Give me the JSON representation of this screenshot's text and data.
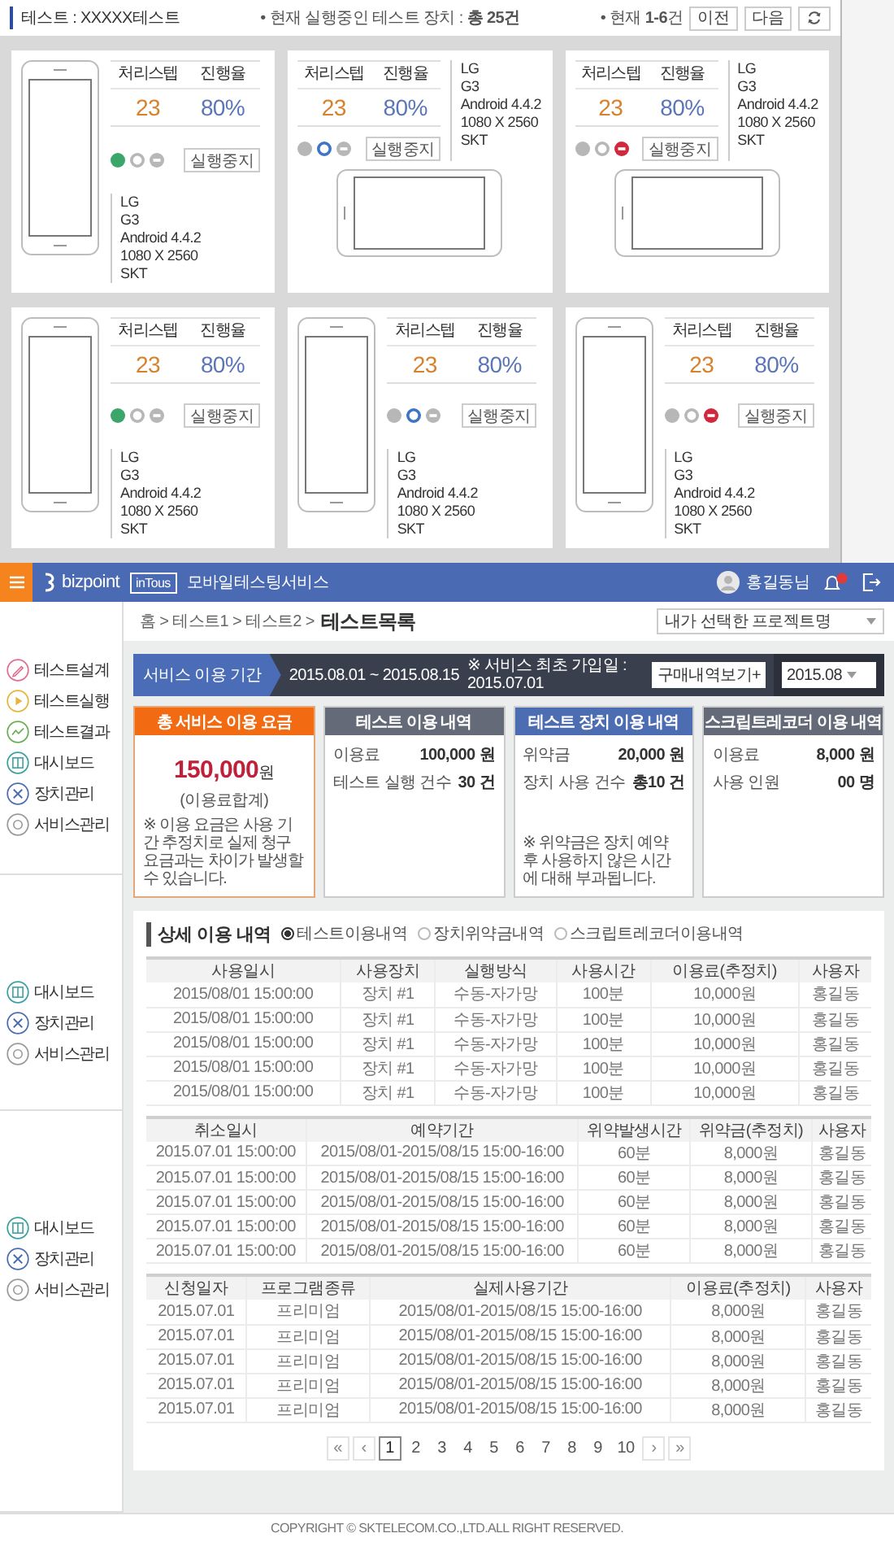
{
  "test_header": {
    "title": "테스트 : XXXXX테스트",
    "running_count": "• 현재 실행중인 테스트 장치 : **총 25건**",
    "page_range": "• 현재 **1-6**건",
    "buttons": [
      "이전",
      "다음"
    ]
  },
  "devices": [
    {
      "kind": "portrait",
      "indicators": [
        {
          "kind": "run",
          "on": true
        },
        {
          "kind": "pause",
          "on": false
        },
        {
          "kind": "stop",
          "on": false
        }
      ],
      "labels": [
        "처리스텝",
        "진행율"
      ],
      "values": [
        "23",
        "80%"
      ],
      "stop_button": "실행중지",
      "info": [
        "LG",
        "G3",
        "Android 4.4.2",
        "1080 X 2560",
        "SKT"
      ]
    },
    {
      "kind": "landscape",
      "indicators": [
        {
          "kind": "run",
          "on": false
        },
        {
          "kind": "pause",
          "on": true
        },
        {
          "kind": "stop",
          "on": false
        }
      ],
      "labels": [
        "처리스텝",
        "진행율"
      ],
      "values": [
        "23",
        "80%"
      ],
      "stop_button": "실행중지",
      "info": [
        "LG",
        "G3",
        "Android 4.4.2",
        "1080 X 2560",
        "SKT"
      ]
    },
    {
      "kind": "landscape",
      "indicators": [
        {
          "kind": "run",
          "on": false
        },
        {
          "kind": "pause",
          "on": false
        },
        {
          "kind": "stop",
          "on": true
        }
      ],
      "labels": [
        "처리스텝",
        "진행율"
      ],
      "values": [
        "23",
        "80%"
      ],
      "stop_button": "실행중지",
      "info": [
        "LG",
        "G3",
        "Android 4.4.2",
        "1080 X 2560",
        "SKT"
      ]
    },
    {
      "kind": "portrait",
      "indicators": [
        {
          "kind": "run",
          "on": true
        },
        {
          "kind": "pause",
          "on": false
        },
        {
          "kind": "stop",
          "on": false
        }
      ],
      "labels": [
        "처리스텝",
        "진행율"
      ],
      "values": [
        "23",
        "80%"
      ],
      "stop_button": "실행중지",
      "info": [
        "LG",
        "G3",
        "Android 4.4.2",
        "1080 X 2560",
        "SKT"
      ]
    },
    {
      "kind": "portrait",
      "indicators": [
        {
          "kind": "run",
          "on": false
        },
        {
          "kind": "pause",
          "on": true
        },
        {
          "kind": "stop",
          "on": false
        }
      ],
      "labels": [
        "처리스텝",
        "진행율"
      ],
      "values": [
        "23",
        "80%"
      ],
      "stop_button": "실행중지",
      "info": [
        "LG",
        "G3",
        "Android 4.4.2",
        "1080 X 2560",
        "SKT"
      ]
    },
    {
      "kind": "portrait",
      "indicators": [
        {
          "kind": "run",
          "on": false
        },
        {
          "kind": "pause",
          "on": false
        },
        {
          "kind": "stop",
          "on": true
        }
      ],
      "labels": [
        "처리스텝",
        "진행율"
      ],
      "values": [
        "23",
        "80%"
      ],
      "stop_button": "실행중지",
      "info": [
        "LG",
        "G3",
        "Android 4.4.2",
        "1080 X 2560",
        "SKT"
      ]
    }
  ],
  "navbar": {
    "brand": "bizpoint",
    "sub_brand": "inTous",
    "service": "모바일테스팅서비스",
    "user": "홍길동님"
  },
  "sidebar_groups": [
    {
      "items": [
        {
          "kind": "design",
          "label": "테스트설계"
        },
        {
          "kind": "run",
          "label": "테스트실행"
        },
        {
          "kind": "result",
          "label": "테스트결과"
        },
        {
          "kind": "dashboard",
          "label": "대시보드"
        },
        {
          "kind": "device",
          "label": "장치관리"
        },
        {
          "kind": "service",
          "label": "서비스관리"
        }
      ]
    },
    {
      "items": [
        {
          "kind": "dashboard",
          "label": "대시보드"
        },
        {
          "kind": "device",
          "label": "장치관리"
        },
        {
          "kind": "service",
          "label": "서비스관리"
        }
      ]
    },
    {
      "items": [
        {
          "kind": "dashboard",
          "label": "대시보드"
        },
        {
          "kind": "device",
          "label": "장치관리"
        },
        {
          "kind": "service",
          "label": "서비스관리"
        }
      ]
    }
  ],
  "breadcrumb": {
    "path": "홈 > 테스트1 > 테스트2 >",
    "current": "테스트목록"
  },
  "project_select": "내가 선택한 프로젝트명",
  "service_period": {
    "label": "서비스 이용 기간",
    "dates": "2015.08.01 ~ 2015.08.15",
    "signup_note": "※ 서비스 최초 가입일 : 2015.07.01",
    "history_button": "구매내역보기+",
    "month_select": "2015.08"
  },
  "summaries": [
    {
      "kind": "total",
      "title": "총 서비스 이용 요금",
      "color": "#f26a12",
      "amount": "150,000",
      "unit": "원",
      "caption": "(이용료합계)",
      "note": "※ 이용 요금은 사용 기간 추정치로 실제 청구 요금과는 차이가 발생할 수 있습니다."
    },
    {
      "kind": "detail",
      "title": "테스트 이용 내역",
      "color": "#646a78",
      "rows": [
        {
          "label": "이용료",
          "value": "100,000 원"
        },
        {
          "label": "테스트 실행 건수",
          "value": "30 건"
        }
      ]
    },
    {
      "kind": "detail",
      "title": "테스트 장치 이용 내역",
      "color": "#4d6db3",
      "rows": [
        {
          "label": "위약금",
          "value": "20,000 원"
        },
        {
          "label": "장치 사용 건수",
          "value": "총10 건"
        }
      ],
      "note": "※ 위약금은 장치 예약 후 사용하지 않은 시간에 대해 부과됩니다."
    },
    {
      "kind": "detail",
      "title": "스크립트레코더 이용 내역",
      "color": "#646a78",
      "rows": [
        {
          "label": "이용료",
          "value": "8,000 원"
        },
        {
          "label": "사용 인원",
          "value": "00 명"
        }
      ]
    }
  ],
  "detail": {
    "title": "상세 이용 내역",
    "filters": [
      {
        "label": "테스트이용내역",
        "selected": true
      },
      {
        "label": "장치위약금내역",
        "selected": false
      },
      {
        "label": "스크립트레코더이용내역",
        "selected": false
      }
    ],
    "tables": [
      {
        "columns": [
          "사용일시",
          "사용장치",
          "실행방식",
          "사용시간",
          "이용료(추정치)",
          "사용자"
        ],
        "rows": [
          [
            "2015/08/01 15:00:00",
            "장치 #1",
            "수동-자가망",
            "100분",
            "10,000원",
            "홍길동"
          ],
          [
            "2015/08/01 15:00:00",
            "장치 #1",
            "수동-자가망",
            "100분",
            "10,000원",
            "홍길동"
          ],
          [
            "2015/08/01 15:00:00",
            "장치 #1",
            "수동-자가망",
            "100분",
            "10,000원",
            "홍길동"
          ],
          [
            "2015/08/01 15:00:00",
            "장치 #1",
            "수동-자가망",
            "100분",
            "10,000원",
            "홍길동"
          ],
          [
            "2015/08/01 15:00:00",
            "장치 #1",
            "수동-자가망",
            "100분",
            "10,000원",
            "홍길동"
          ]
        ]
      },
      {
        "columns": [
          "취소일시",
          "예약기간",
          "위약발생시간",
          "위약금(추정치)",
          "사용자"
        ],
        "rows": [
          [
            "2015.07.01 15:00:00",
            "2015/08/01-2015/08/15 15:00-16:00",
            "60분",
            "8,000원",
            "홍길동"
          ],
          [
            "2015.07.01 15:00:00",
            "2015/08/01-2015/08/15 15:00-16:00",
            "60분",
            "8,000원",
            "홍길동"
          ],
          [
            "2015.07.01 15:00:00",
            "2015/08/01-2015/08/15 15:00-16:00",
            "60분",
            "8,000원",
            "홍길동"
          ],
          [
            "2015.07.01 15:00:00",
            "2015/08/01-2015/08/15 15:00-16:00",
            "60분",
            "8,000원",
            "홍길동"
          ],
          [
            "2015.07.01 15:00:00",
            "2015/08/01-2015/08/15 15:00-16:00",
            "60분",
            "8,000원",
            "홍길동"
          ]
        ]
      },
      {
        "columns": [
          "신청일자",
          "프로그램종류",
          "실제사용기간",
          "이용료(추정치)",
          "사용자"
        ],
        "rows": [
          [
            "2015.07.01",
            "프리미엄",
            "2015/08/01-2015/08/15 15:00-16:00",
            "8,000원",
            "홍길동"
          ],
          [
            "2015.07.01",
            "프리미엄",
            "2015/08/01-2015/08/15 15:00-16:00",
            "8,000원",
            "홍길동"
          ],
          [
            "2015.07.01",
            "프리미엄",
            "2015/08/01-2015/08/15 15:00-16:00",
            "8,000원",
            "홍길동"
          ],
          [
            "2015.07.01",
            "프리미엄",
            "2015/08/01-2015/08/15 15:00-16:00",
            "8,000원",
            "홍길동"
          ],
          [
            "2015.07.01",
            "프리미엄",
            "2015/08/01-2015/08/15 15:00-16:00",
            "8,000원",
            "홍길동"
          ]
        ]
      }
    ]
  },
  "pagination": {
    "first": "«",
    "prev": "‹",
    "pages": [
      {
        "label": "1",
        "selected": true
      },
      {
        "label": "2",
        "selected": false
      },
      {
        "label": "3",
        "selected": false
      },
      {
        "label": "4",
        "selected": false
      },
      {
        "label": "5",
        "selected": false
      },
      {
        "label": "6",
        "selected": false
      },
      {
        "label": "7",
        "selected": false
      },
      {
        "label": "8",
        "selected": false
      },
      {
        "label": "9",
        "selected": false
      },
      {
        "label": "10",
        "selected": false
      }
    ],
    "next": "›",
    "last": "»"
  },
  "footer": "COPYRIGHT © SKTELECOM.CO.,LTD.ALL RIGHT RESERVED."
}
